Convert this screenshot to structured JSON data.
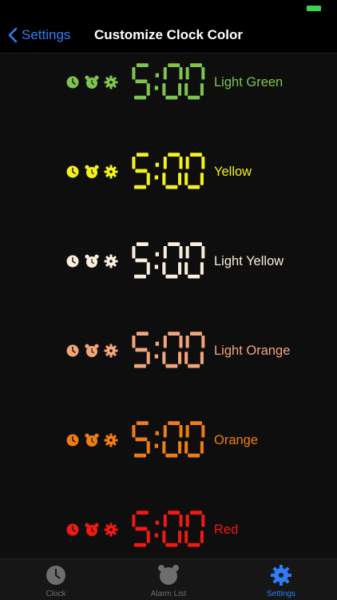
{
  "nav": {
    "back_label": "Settings",
    "title": "Customize Clock Color"
  },
  "clock_sample": "5:00",
  "colors": [
    {
      "label": "Light Green",
      "color": "#7fc44e"
    },
    {
      "label": "Yellow",
      "color": "#f5f21b"
    },
    {
      "label": "Light Yellow",
      "color": "#f7eedb"
    },
    {
      "label": "Light Orange",
      "color": "#f3a57a"
    },
    {
      "label": "Orange",
      "color": "#ef7d14"
    },
    {
      "label": "Red",
      "color": "#f01a12"
    }
  ],
  "tabs": [
    {
      "label": "Clock",
      "icon": "clock-icon",
      "color": "#6e6e6e"
    },
    {
      "label": "Alarm List",
      "icon": "alarm-icon",
      "color": "#6e6e6e"
    },
    {
      "label": "Settings",
      "icon": "gear-icon",
      "color": "#2f7df6"
    }
  ]
}
